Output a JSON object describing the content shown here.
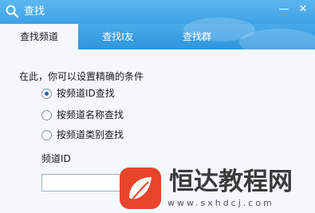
{
  "window": {
    "title": "查找",
    "minimize_glyph": "—",
    "close_glyph": "✕",
    "title_icon": "search-icon"
  },
  "tabs": [
    {
      "label": "查找频道",
      "active": true
    },
    {
      "label": "查找I友",
      "active": false
    },
    {
      "label": "查找群",
      "active": false
    }
  ],
  "form": {
    "prompt": "在此，你可以设置精确的条件",
    "options": [
      {
        "label": "按频道ID查找",
        "checked": true
      },
      {
        "label": "按频道名称查找",
        "checked": false
      },
      {
        "label": "按频道类别查找",
        "checked": false
      }
    ],
    "field_label": "频道ID",
    "field_value": ""
  },
  "watermark": {
    "title": "恒达教程网",
    "url": "www.sxhdcj.com",
    "colors": {
      "logo_red": "#e8452c",
      "text": "#3a3a3a"
    }
  },
  "colors": {
    "titlebar": "#4aaaea",
    "content_bg": "#f4f8fb",
    "active_tab_bg": "#f4f8fb"
  }
}
